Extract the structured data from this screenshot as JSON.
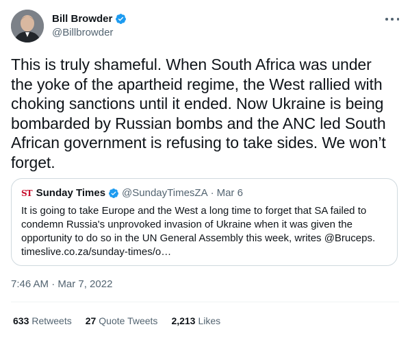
{
  "author": {
    "display_name": "Bill Browder",
    "handle": "@Billbrowder",
    "verified_color": "#1d9bf0"
  },
  "tweet": {
    "text": "This is truly shameful. When South Africa was under\nthe yoke of the apartheid regime, the West rallied with\nchoking sanctions until it ended. Now Ukraine is being\nbombarded by Russian bombs and the ANC led South\nAfrican government is refusing to take sides. We won’t\nforget.",
    "timestamp": "7:46 AM · Mar 7, 2022"
  },
  "quote": {
    "logo": "ST",
    "display_name": "Sunday Times",
    "handle": "@SundayTimesZA",
    "separator": "·",
    "date": "Mar 6",
    "text": "It is going to take Europe and the West a long time to forget that SA failed to\ncondemn Russia's unprovoked invasion of Ukraine when it was given the\nopportunity to do so in the UN General Assembly this week, writes @Bruceps.\ntimeslive.co.za/sunday-times/o…"
  },
  "stats": [
    {
      "count": "633",
      "label": "Retweets"
    },
    {
      "count": "27",
      "label": "Quote Tweets"
    },
    {
      "count": "2,213",
      "label": "Likes"
    }
  ],
  "icons": {
    "avatar": "profile-photo",
    "verified": "verified-badge-icon",
    "more": "more-options-icon"
  }
}
